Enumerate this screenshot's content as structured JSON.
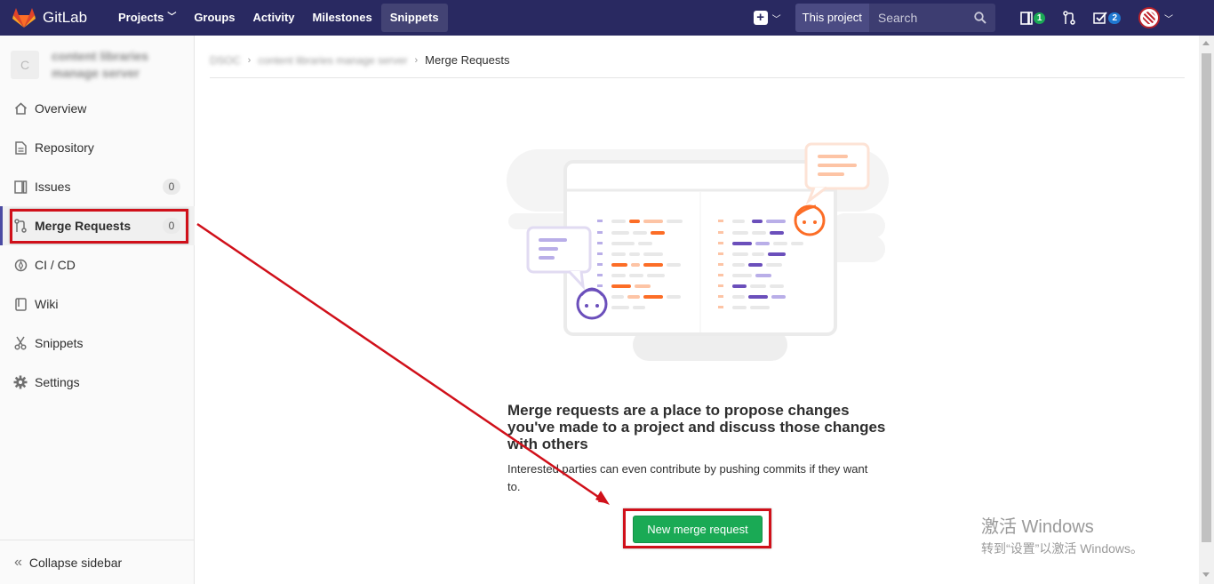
{
  "navbar": {
    "brand": "GitLab",
    "links": [
      {
        "label": "Projects",
        "chevron": true
      },
      {
        "label": "Groups"
      },
      {
        "label": "Activity"
      },
      {
        "label": "Milestones"
      },
      {
        "label": "Snippets"
      }
    ],
    "search_scope": "This project",
    "search_placeholder": "Search",
    "issues_count": "1",
    "todos_count": "2",
    "bg_color": "#292961"
  },
  "sidebar": {
    "project_avatar_letter": "C",
    "project_name": "content libraries manage server",
    "items": [
      {
        "label": "Overview",
        "icon": "home-icon"
      },
      {
        "label": "Repository",
        "icon": "repository-icon"
      },
      {
        "label": "Issues",
        "icon": "issues-icon",
        "count": "0"
      },
      {
        "label": "Merge Requests",
        "icon": "merge-request-icon",
        "count": "0",
        "active": true
      },
      {
        "label": "CI / CD",
        "icon": "rocket-icon"
      },
      {
        "label": "Wiki",
        "icon": "book-icon"
      },
      {
        "label": "Snippets",
        "icon": "scissors-icon"
      },
      {
        "label": "Settings",
        "icon": "gear-icon"
      }
    ],
    "collapse_label": "Collapse sidebar"
  },
  "breadcrumb": {
    "group": "DSOC",
    "project": "content libraries manage server",
    "current": "Merge Requests"
  },
  "empty_state": {
    "title": "Merge requests are a place to propose changes you've made to a project and discuss those changes with others",
    "text": "Interested parties can even contribute by pushing commits if they want to.",
    "button": "New merge request",
    "button_color": "#1aaa55"
  },
  "watermark": {
    "line1": "激活 Windows",
    "line2": "转到“设置”以激活 Windows。"
  },
  "annotation_color": "#d0101a"
}
